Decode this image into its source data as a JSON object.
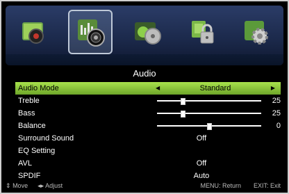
{
  "header": {
    "title": "Audio",
    "categories": [
      {
        "name": "picture",
        "icon": "picture-camera-icon"
      },
      {
        "name": "audio",
        "icon": "audio-speaker-icon",
        "selected": true
      },
      {
        "name": "channel",
        "icon": "channel-disc-icon"
      },
      {
        "name": "lock",
        "icon": "lock-icon"
      },
      {
        "name": "setup",
        "icon": "gear-icon"
      }
    ]
  },
  "menu": {
    "audio_mode": {
      "label": "Audio Mode",
      "value": "Standard"
    },
    "treble": {
      "label": "Treble",
      "value": "25",
      "level": 0.25
    },
    "bass": {
      "label": "Bass",
      "value": "25",
      "level": 0.25
    },
    "balance": {
      "label": "Balance",
      "value": "0",
      "level": 0.5
    },
    "surround": {
      "label": "Surround Sound",
      "value": "Off"
    },
    "eq": {
      "label": "EQ Setting"
    },
    "avl": {
      "label": "AVL",
      "value": "Off"
    },
    "spdif": {
      "label": "SPDIF",
      "value": "Auto"
    }
  },
  "footer": {
    "move": "Move",
    "adjust": "Adjust",
    "menu_return": "MENU: Return",
    "exit": "EXIT: Exit"
  },
  "colors": {
    "selection": "#8cc63f",
    "topbar": "#22335a"
  }
}
